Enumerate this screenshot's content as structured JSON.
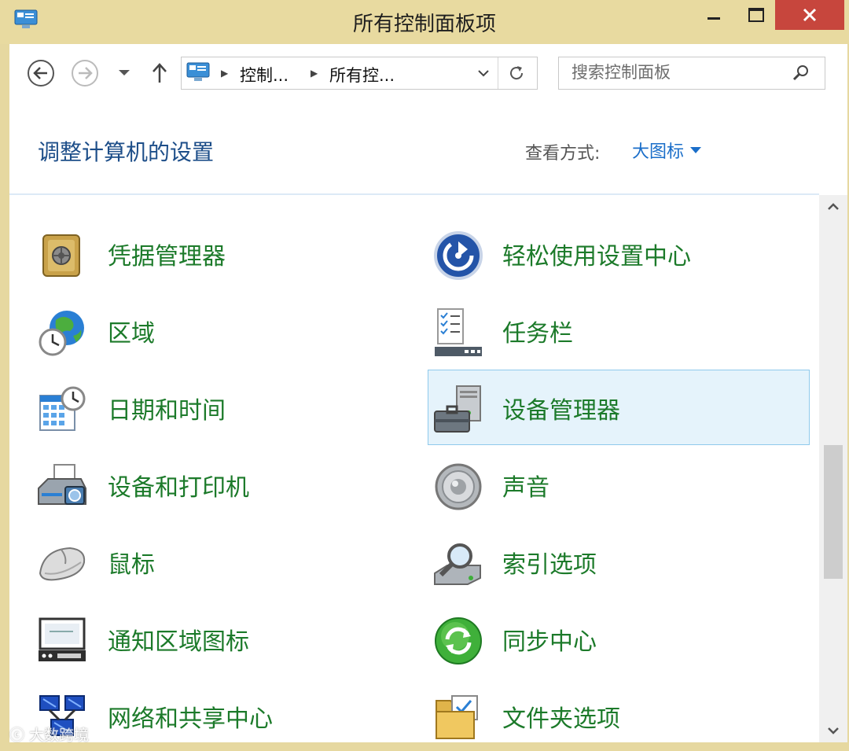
{
  "window": {
    "title": "所有控制面板项"
  },
  "toolbar": {
    "breadcrumbs": [
      "控制...",
      "所有控..."
    ],
    "search_placeholder": "搜索控制面板"
  },
  "header": {
    "title": "调整计算机的设置",
    "view_label": "查看方式:",
    "view_value": "大图标"
  },
  "items": [
    {
      "label": "凭据管理器",
      "icon": "credential-vault-icon"
    },
    {
      "label": "轻松使用设置中心",
      "icon": "ease-of-access-icon"
    },
    {
      "label": "区域",
      "icon": "region-globe-icon"
    },
    {
      "label": "任务栏",
      "icon": "taskbar-icon"
    },
    {
      "label": "日期和时间",
      "icon": "calendar-clock-icon"
    },
    {
      "label": "设备管理器",
      "icon": "device-manager-icon"
    },
    {
      "label": "设备和打印机",
      "icon": "printer-icon"
    },
    {
      "label": "声音",
      "icon": "speaker-icon"
    },
    {
      "label": "鼠标",
      "icon": "mouse-icon"
    },
    {
      "label": "索引选项",
      "icon": "indexing-magnifier-icon"
    },
    {
      "label": "通知区域图标",
      "icon": "notification-area-icon"
    },
    {
      "label": "同步中心",
      "icon": "sync-center-icon"
    },
    {
      "label": "网络和共享中心",
      "icon": "network-icon"
    },
    {
      "label": "文件夹选项",
      "icon": "folder-options-icon"
    }
  ],
  "watermark": "大数跨境",
  "colors": {
    "title_bar": "#e8daa0",
    "close_button": "#c7463d",
    "link_green": "#1c7a2a",
    "heading_blue": "#1d4e89",
    "selection_bg": "#e5f3fb"
  }
}
